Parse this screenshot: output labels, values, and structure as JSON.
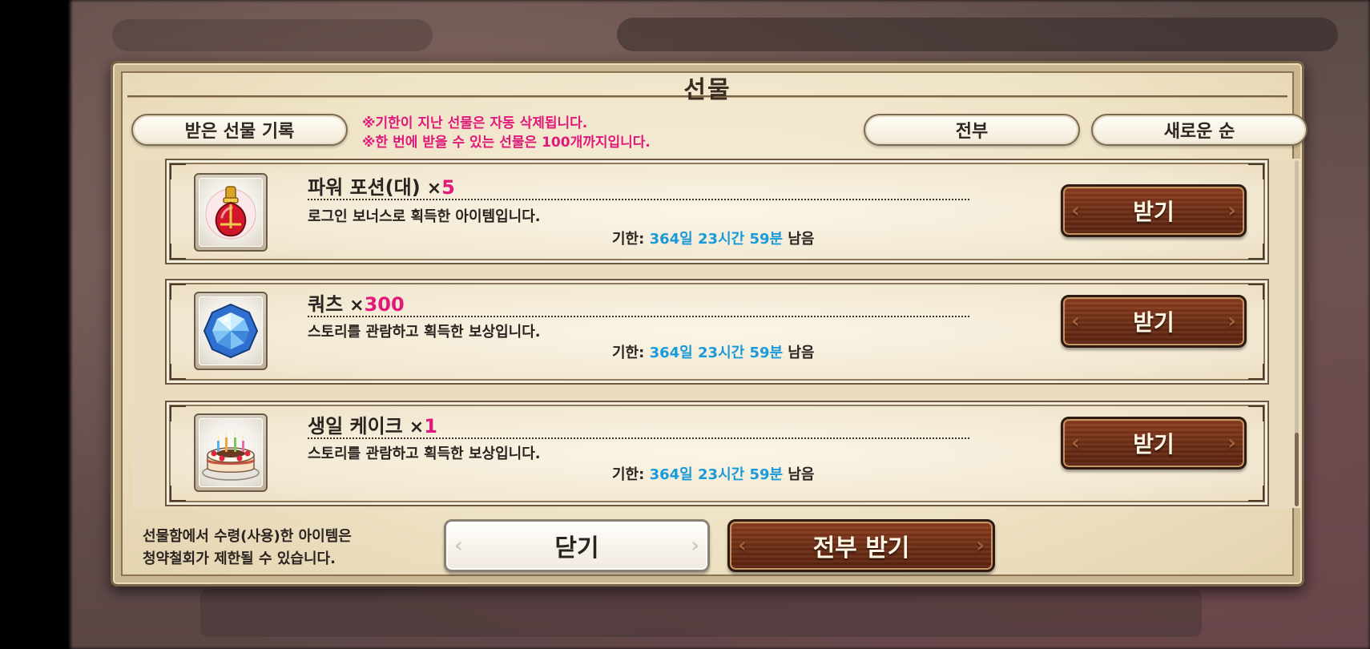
{
  "dialog": {
    "title": "선물"
  },
  "toolbar": {
    "history_label": "받은 선물 기록",
    "filter_label": "전부",
    "sort_label": "새로운 순"
  },
  "notices": [
    "※기한이 지난 선물은 자동 삭제됩니다.",
    "※한 번에 받을 수 있는 선물은 100개까지입니다."
  ],
  "gifts": [
    {
      "icon": "power-potion-icon",
      "name": "파워 포션(대)",
      "qty_prefix": "×",
      "qty": "5",
      "desc": "로그인 보너스로 획득한 아이템입니다.",
      "expiry_label": "기한: ",
      "expiry_days": "364일",
      "expiry_hours": "23시간",
      "expiry_minutes": "59분",
      "expiry_suffix": " 남음",
      "claim_label": "받기"
    },
    {
      "icon": "quartz-crystal-icon",
      "name": "쿼츠",
      "qty_prefix": "×",
      "qty": "300",
      "desc": "스토리를 관람하고 획득한 보상입니다.",
      "expiry_label": "기한: ",
      "expiry_days": "364일",
      "expiry_hours": "23시간",
      "expiry_minutes": "59분",
      "expiry_suffix": " 남음",
      "claim_label": "받기"
    },
    {
      "icon": "birthday-cake-icon",
      "name": "생일 케이크",
      "qty_prefix": "×",
      "qty": "1",
      "desc": "스토리를 관람하고 획득한 보상입니다.",
      "expiry_label": "기한: ",
      "expiry_days": "364일",
      "expiry_hours": "23시간",
      "expiry_minutes": "59분",
      "expiry_suffix": " 남음",
      "claim_label": "받기"
    }
  ],
  "footer": {
    "note_line1": "선물함에서 수령(사용)한 아이템은",
    "note_line2": "청약철회가 제한될 수 있습니다.",
    "close_label": "닫기",
    "claim_all_label": "전부 받기"
  },
  "colors": {
    "accent_pink": "#e0197a",
    "expiry_blue": "#1a9ad8",
    "button_brown": "#6b2c14"
  }
}
